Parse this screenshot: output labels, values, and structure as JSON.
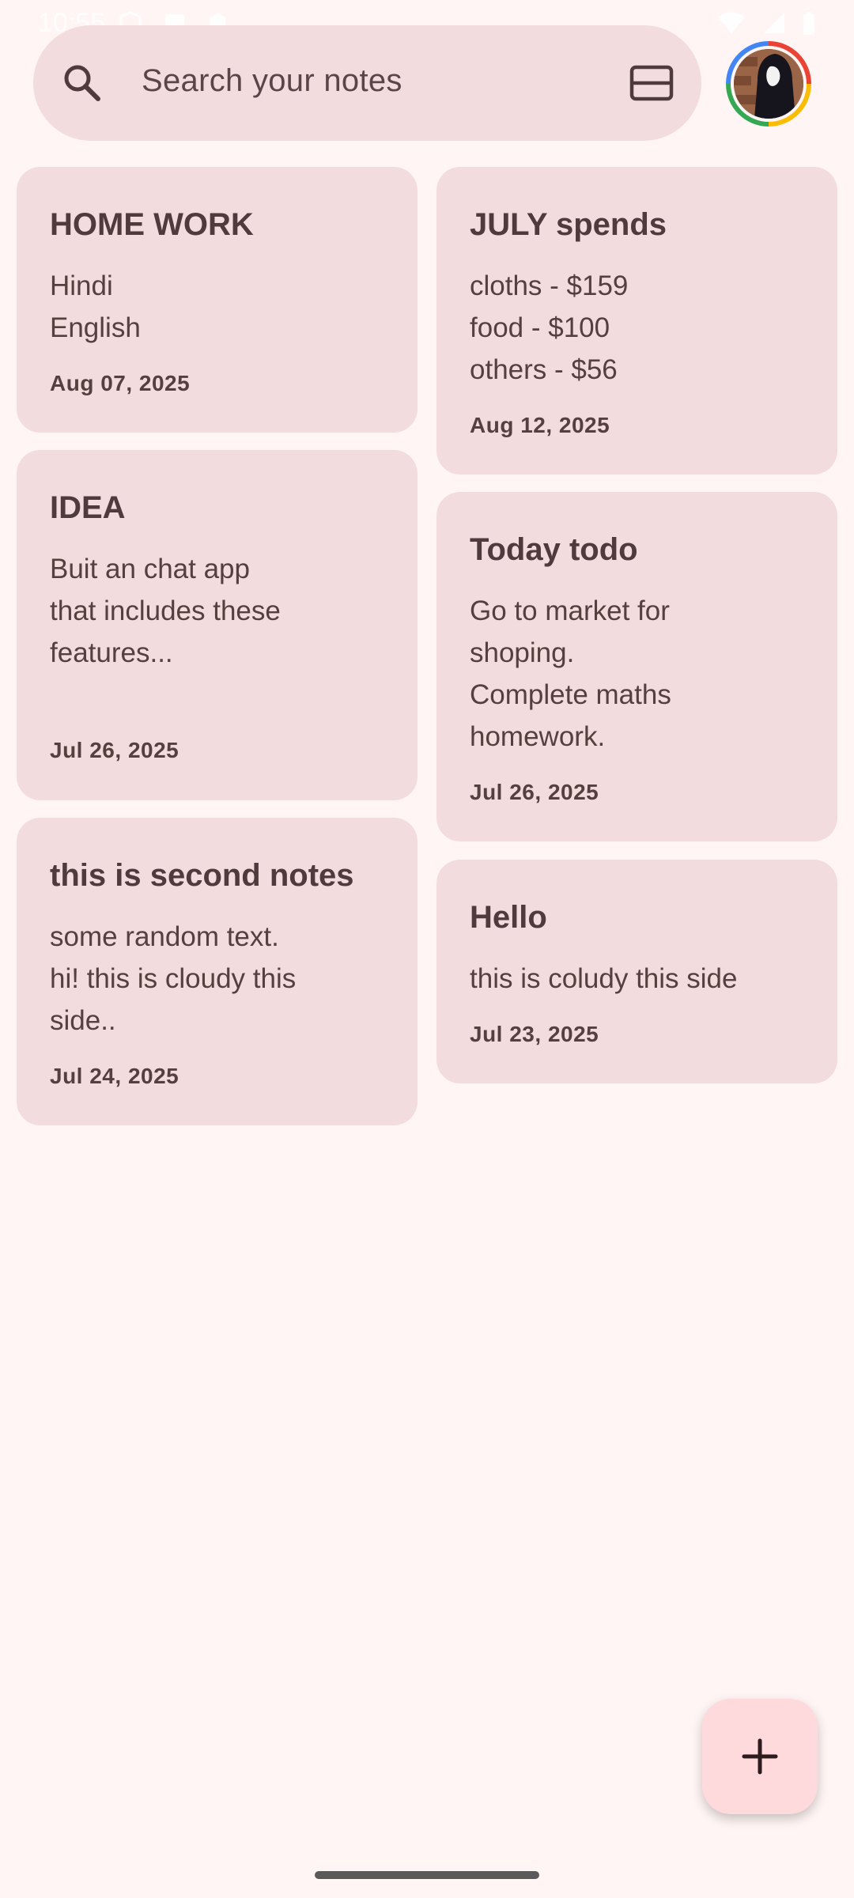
{
  "status_bar": {
    "time": "10:55"
  },
  "search": {
    "placeholder": "Search your notes"
  },
  "colors": {
    "background": "#fff5f4",
    "card": "#f2dcde",
    "text": "#4f3b3e",
    "fab": "#ffdadd"
  },
  "icons": {
    "search": "search-icon",
    "layout": "layout-toggle-icon",
    "avatar": "account-avatar",
    "fab": "plus-icon"
  },
  "notes": [
    {
      "title": "HOME WORK",
      "body": "Hindi\nEnglish",
      "date": "Aug 07, 2025"
    },
    {
      "title": "JULY spends",
      "body": "cloths - $159\nfood - $100\nothers - $56",
      "date": "Aug 12, 2025"
    },
    {
      "title": "IDEA",
      "body": "Buit an chat app\nthat includes these\nfeatures...",
      "date": "Jul 26, 2025"
    },
    {
      "title": "Today todo",
      "body": "Go to market for\nshoping.\nComplete maths\nhomework.",
      "date": "Jul 26, 2025"
    },
    {
      "title": "this is second notes",
      "body": "some random text.\nhi! this is cloudy this\nside..",
      "date": "Jul 24, 2025"
    },
    {
      "title": "Hello",
      "body": "this is coludy this side",
      "date": "Jul 23, 2025"
    }
  ]
}
